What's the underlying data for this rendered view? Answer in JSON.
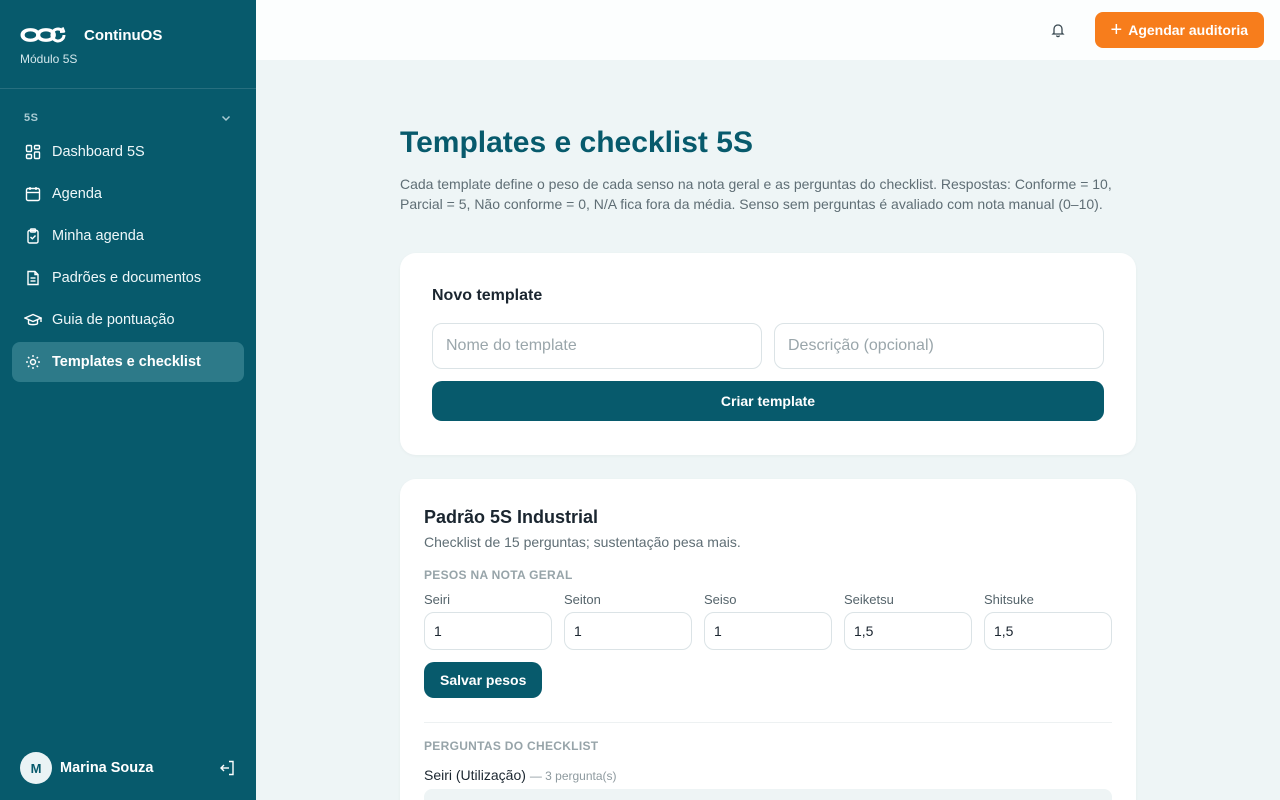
{
  "app": {
    "brand_name": "ContinuOS",
    "module": "Módulo 5S"
  },
  "sidebar": {
    "section": "5S",
    "items": [
      {
        "label": "Dashboard 5S",
        "icon": "dashboard-icon",
        "active": false
      },
      {
        "label": "Agenda",
        "icon": "calendar-icon",
        "active": false
      },
      {
        "label": "Minha agenda",
        "icon": "clipboard-check-icon",
        "active": false
      },
      {
        "label": "Padrões e documentos",
        "icon": "document-icon",
        "active": false
      },
      {
        "label": "Guia de pontuação",
        "icon": "graduation-cap-icon",
        "active": false
      },
      {
        "label": "Templates e checklist",
        "icon": "gear-icon",
        "active": true
      }
    ],
    "user": {
      "initial": "M",
      "name": "Marina Souza"
    }
  },
  "topbar": {
    "cta_label": "Agendar auditoria",
    "cta_color": "#f77d1c"
  },
  "page": {
    "title": "Templates e checklist 5S",
    "description": "Cada template define o peso de cada senso na nota geral e as perguntas do checklist. Respostas: Conforme = 10, Parcial = 5, Não conforme = 0, N/A fica fora da média. Senso sem perguntas é avaliado com nota manual (0–10)."
  },
  "new_template": {
    "title": "Novo template",
    "name_placeholder": "Nome do template",
    "desc_placeholder": "Descrição (opcional)",
    "submit_label": "Criar template"
  },
  "template": {
    "name": "Padrão 5S Industrial",
    "description": "Checklist de 15 perguntas; sustentação pesa mais.",
    "weights_heading": "PESOS NA NOTA GERAL",
    "weights": [
      {
        "label": "Seiri",
        "value": "1"
      },
      {
        "label": "Seiton",
        "value": "1"
      },
      {
        "label": "Seiso",
        "value": "1"
      },
      {
        "label": "Seiketsu",
        "value": "1,5"
      },
      {
        "label": "Shitsuke",
        "value": "1,5"
      }
    ],
    "save_label": "Salvar pesos",
    "questions_heading": "PERGUNTAS DO CHECKLIST",
    "first_sense": "Seiri (Utilização)",
    "first_sense_count": "— 3 pergunta(s)"
  },
  "colors": {
    "primary": "#075a6c",
    "accent": "#f77d1c",
    "background": "#eef5f6"
  }
}
